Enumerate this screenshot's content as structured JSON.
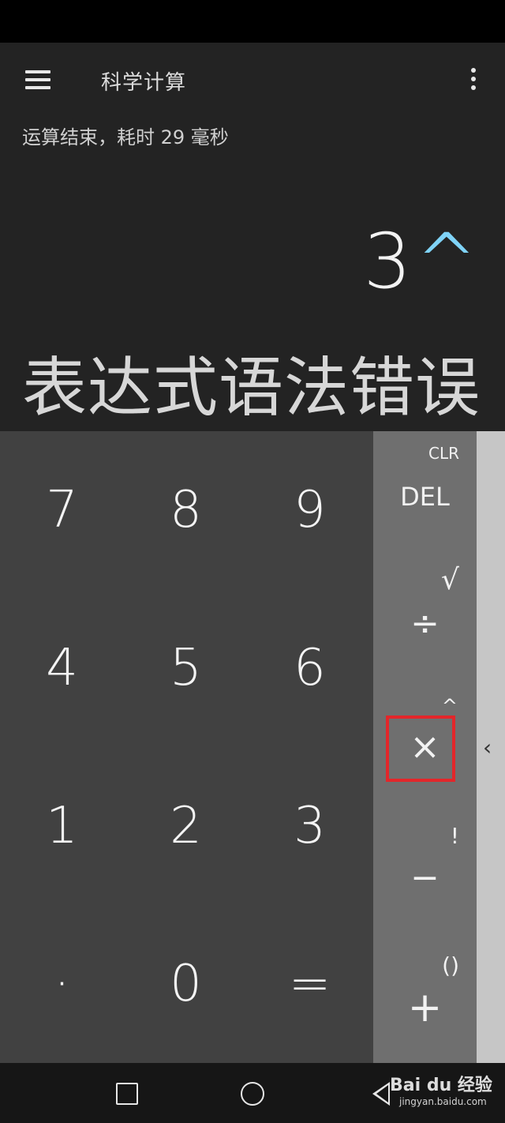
{
  "app": {
    "title": "科学计算"
  },
  "display": {
    "status_message": "运算结束，耗时 29 毫秒",
    "expression": "3",
    "expression_operator": "^",
    "result": "表达式语法错误"
  },
  "numpad": {
    "keys": [
      "7",
      "8",
      "9",
      "4",
      "5",
      "6",
      "1",
      "2",
      "3",
      "·",
      "0",
      "="
    ]
  },
  "operators": {
    "clear": "CLR",
    "delete": "DEL",
    "sqrt": "√",
    "divide": "÷",
    "power": "^",
    "multiply": "×",
    "factorial": "!",
    "minus": "−",
    "parentheses": "()",
    "plus": "+"
  },
  "sidebar": {
    "chevron": "‹"
  },
  "watermark": {
    "main": "Bai du 经验",
    "sub": "jingyan.baidu.com"
  },
  "colors": {
    "accent": "#7fd3f7",
    "highlight": "#e3262a"
  }
}
